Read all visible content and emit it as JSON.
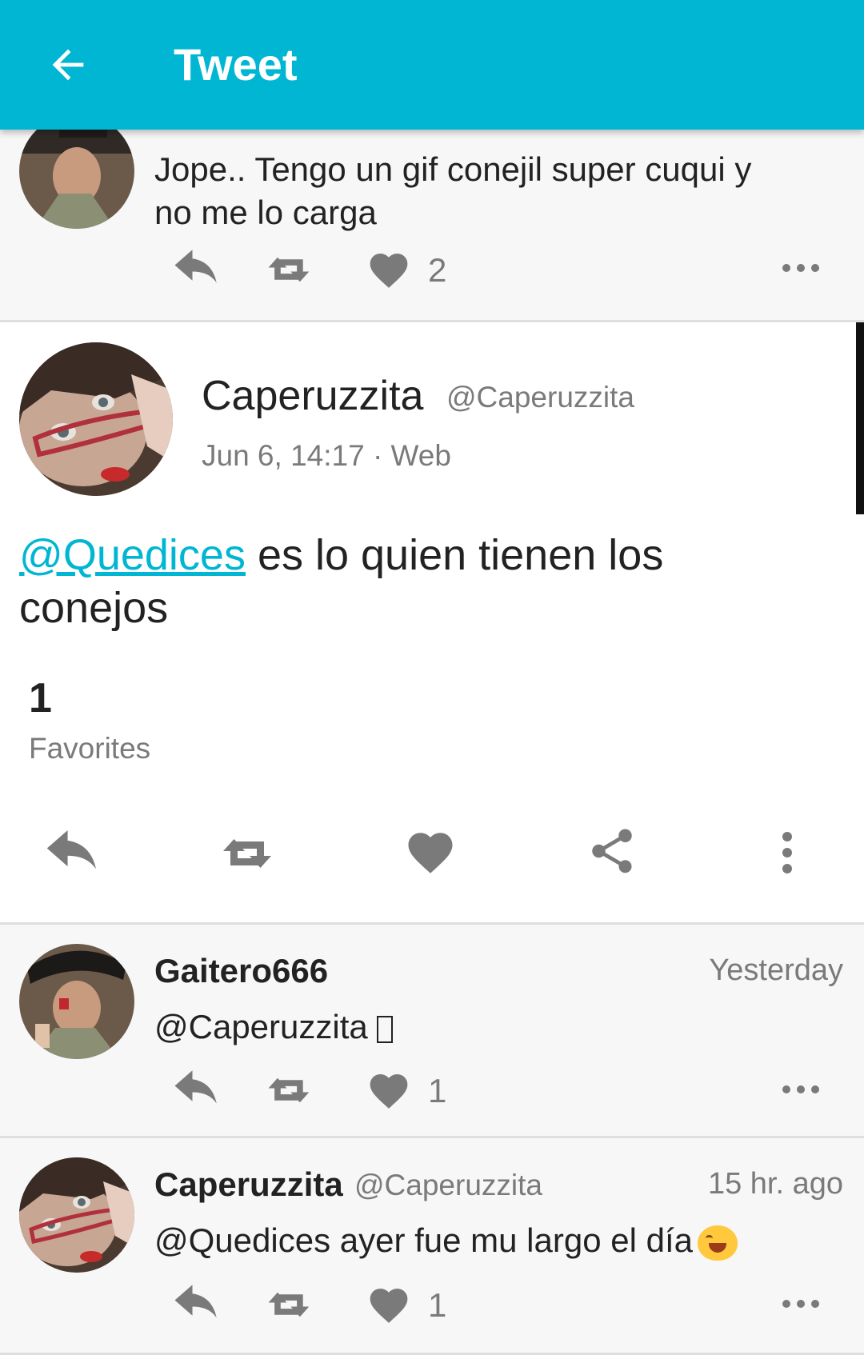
{
  "topbar": {
    "title": "Tweet",
    "back_icon": "arrow-left-icon",
    "color": "#00B6D3"
  },
  "prev_tweet": {
    "text_line1": "Jope.. Tengo un gif conejil super cuqui y",
    "text_line2": "no me lo carga",
    "favorites": "2"
  },
  "main_tweet": {
    "name": "Caperuzzita",
    "handle": "@Caperuzzita",
    "meta": "Jun 6, 14:17 · Web",
    "mention": "@Quedices",
    "text_rest": " es lo quien tienen los",
    "text_line2": "conejos",
    "fav_count": "1",
    "fav_label": "Favorites"
  },
  "replies": [
    {
      "name": "Gaitero666",
      "time": "Yesterday",
      "text": "@Caperuzzita ",
      "favorites": "1"
    },
    {
      "name": "Caperuzzita",
      "handle": "@Caperuzzita",
      "time": "15 hr. ago",
      "text": "@Quedices  ayer fue mu largo el día",
      "favorites": "1"
    }
  ],
  "colors": {
    "accent": "#00B6D3",
    "icon_gray": "#7a7a7a"
  }
}
